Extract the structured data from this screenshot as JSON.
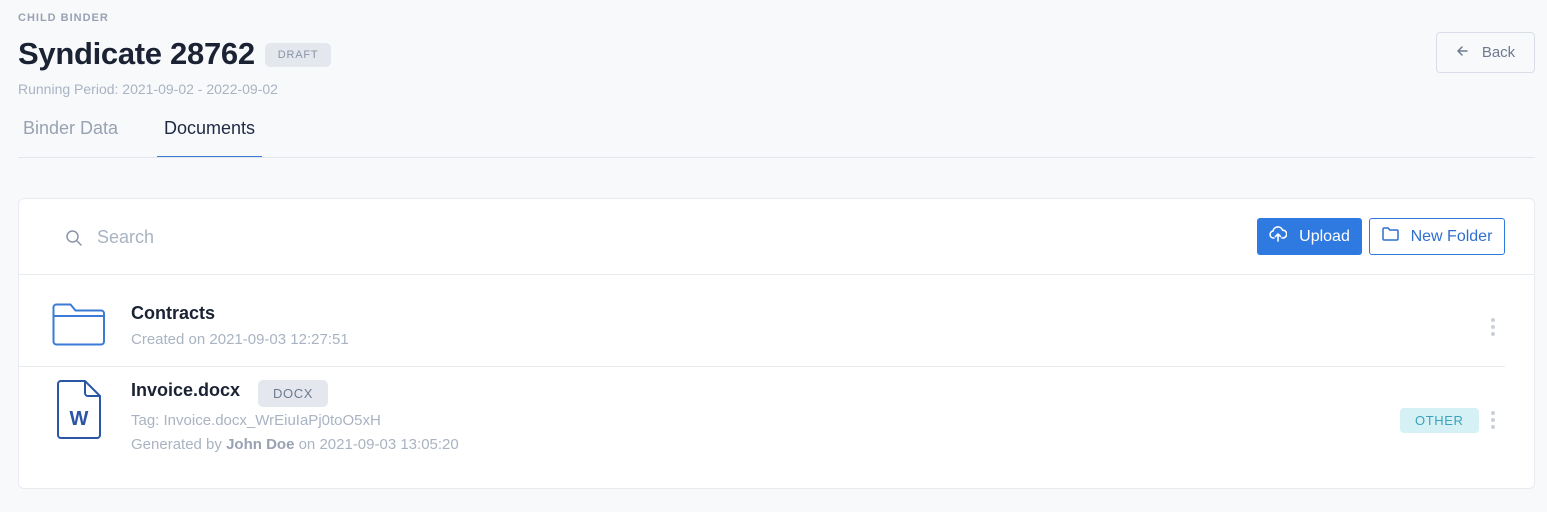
{
  "header": {
    "eyebrow": "CHILD BINDER",
    "title": "Syndicate 28762",
    "status_badge": "DRAFT",
    "running_period": "Running Period: 2021-09-02 - 2022-09-02",
    "back_label": "Back"
  },
  "tabs": [
    {
      "label": "Binder Data",
      "active": false
    },
    {
      "label": "Documents",
      "active": true
    }
  ],
  "toolbar": {
    "search_placeholder": "Search",
    "search_value": "",
    "upload_label": "Upload",
    "new_folder_label": "New Folder"
  },
  "items": [
    {
      "type": "folder",
      "name": "Contracts",
      "meta": "Created on 2021-09-03 12:27:51",
      "icon": "folder-icon"
    },
    {
      "type": "file",
      "name": "Invoice.docx",
      "extension_badge": "DOCX",
      "tag_line": "Tag: Invoice.docx_WrEiuIaPj0toO5xH",
      "generated_prefix": "Generated by",
      "generated_user": "John Doe",
      "generated_suffix": "on 2021-09-03 13:05:20",
      "category_badge": "OTHER",
      "icon": "word-document-icon",
      "icon_letter": "W"
    }
  ],
  "colors": {
    "accent": "#2f7ae0",
    "page_background": "#f8f9fb",
    "other_badge_bg": "#d6f1f5",
    "other_badge_text": "#3aa3bb"
  }
}
